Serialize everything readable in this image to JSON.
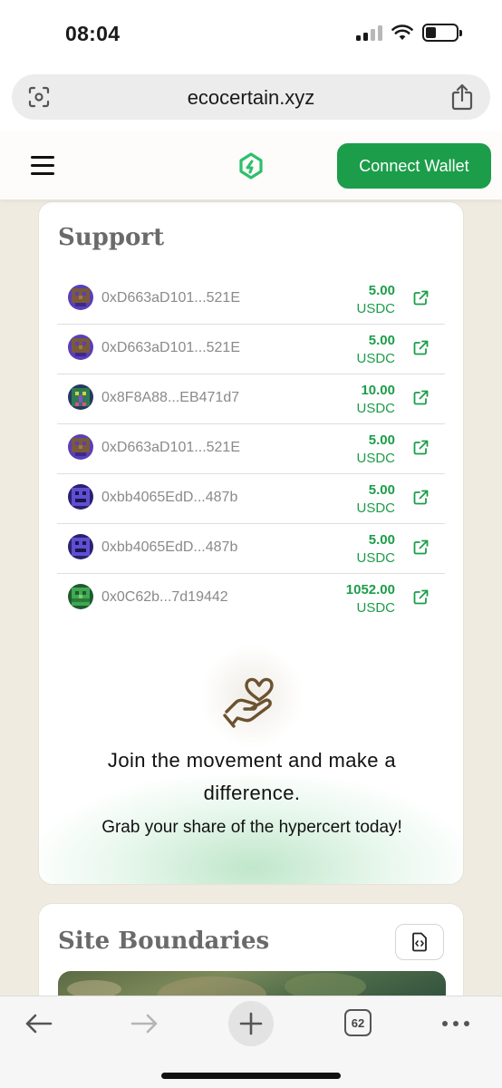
{
  "status_bar": {
    "time": "08:04"
  },
  "browser": {
    "url": "ecocertain.xyz",
    "tab_count": "62"
  },
  "header": {
    "connect_wallet_label": "Connect Wallet",
    "accent_color": "#1c9d4a"
  },
  "support": {
    "title": "Support",
    "supporters": [
      {
        "address": "0xD663aD101...521E",
        "amount": "5.00",
        "currency": "USDC",
        "avatar": "brown-purple-pixel"
      },
      {
        "address": "0xD663aD101...521E",
        "amount": "5.00",
        "currency": "USDC",
        "avatar": "brown-purple-pixel"
      },
      {
        "address": "0x8F8A88...EB471d7",
        "amount": "10.00",
        "currency": "USDC",
        "avatar": "green-navy-pixel"
      },
      {
        "address": "0xD663aD101...521E",
        "amount": "5.00",
        "currency": "USDC",
        "avatar": "brown-purple-pixel"
      },
      {
        "address": "0xbb4065EdD...487b",
        "amount": "5.00",
        "currency": "USDC",
        "avatar": "indigo-face-pixel"
      },
      {
        "address": "0xbb4065EdD...487b",
        "amount": "5.00",
        "currency": "USDC",
        "avatar": "indigo-face-pixel"
      },
      {
        "address": "0x0C62b...7d19442",
        "amount": "1052.00",
        "currency": "USDC",
        "avatar": "green-pixel"
      }
    ],
    "cta_title": "Join the movement and make a difference.",
    "cta_subtitle": "Grab your share of the hypercert today!"
  },
  "site_boundaries": {
    "title": "Site Boundaries"
  }
}
